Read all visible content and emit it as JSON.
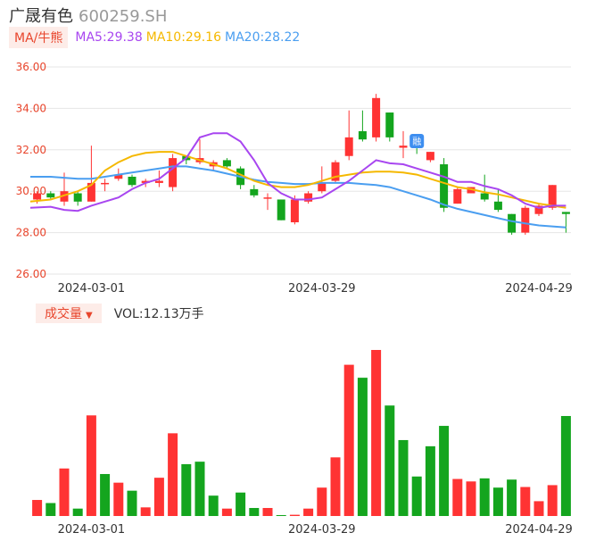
{
  "header": {
    "name": "广晟有色",
    "code": "600259.SH"
  },
  "ma_legend": {
    "badge": "MA/牛熊",
    "items": [
      {
        "text": "MA5:29.38",
        "color": "#a846f0"
      },
      {
        "text": "MA10:29.16",
        "color": "#f5b800"
      },
      {
        "text": "MA20:28.22",
        "color": "#4a9ef0"
      }
    ]
  },
  "volume_legend": {
    "badge": "成交量",
    "value": "VOL:12.13万手"
  },
  "colors": {
    "up": "#ff3333",
    "down": "#14a51e",
    "axis_label": "#e8452c",
    "grid": "#e6e6e6"
  },
  "chart_data": [
    {
      "type": "candlestick",
      "yticks": [
        "36.00",
        "34.00",
        "32.00",
        "30.00",
        "28.00",
        "26.00"
      ],
      "ylim": [
        26,
        36
      ],
      "xticks": [
        {
          "label": "2024-03-01",
          "index": 4
        },
        {
          "label": "2024-03-29",
          "index": 21
        },
        {
          "label": "2024-04-29",
          "index": 37
        }
      ],
      "candles": [
        {
          "o": 29.6,
          "c": 29.9,
          "h": 30.0,
          "l": 29.4
        },
        {
          "o": 29.9,
          "c": 29.7,
          "h": 30.0,
          "l": 29.6
        },
        {
          "o": 29.5,
          "c": 30.0,
          "h": 30.9,
          "l": 29.3
        },
        {
          "o": 29.9,
          "c": 29.5,
          "h": 30.0,
          "l": 29.3
        },
        {
          "o": 29.5,
          "c": 30.4,
          "h": 32.2,
          "l": 29.5
        },
        {
          "o": 30.4,
          "c": 30.4,
          "h": 30.6,
          "l": 30.0
        },
        {
          "o": 30.6,
          "c": 30.8,
          "h": 31.1,
          "l": 30.5
        },
        {
          "o": 30.7,
          "c": 30.3,
          "h": 30.8,
          "l": 30.2
        },
        {
          "o": 30.4,
          "c": 30.5,
          "h": 30.6,
          "l": 30.2
        },
        {
          "o": 30.4,
          "c": 30.5,
          "h": 31.0,
          "l": 30.2
        },
        {
          "o": 30.2,
          "c": 31.6,
          "h": 31.8,
          "l": 30.0
        },
        {
          "o": 31.7,
          "c": 31.5,
          "h": 31.7,
          "l": 31.3
        },
        {
          "o": 31.4,
          "c": 31.6,
          "h": 32.5,
          "l": 31.3
        },
        {
          "o": 31.2,
          "c": 31.4,
          "h": 31.5,
          "l": 31.0
        },
        {
          "o": 31.5,
          "c": 31.2,
          "h": 31.6,
          "l": 31.1
        },
        {
          "o": 31.1,
          "c": 30.3,
          "h": 31.2,
          "l": 30.1
        },
        {
          "o": 30.1,
          "c": 29.8,
          "h": 30.3,
          "l": 29.7
        },
        {
          "o": 29.7,
          "c": 29.7,
          "h": 29.9,
          "l": 29.1
        },
        {
          "o": 29.6,
          "c": 28.6,
          "h": 29.6,
          "l": 28.6
        },
        {
          "o": 28.5,
          "c": 29.6,
          "h": 29.8,
          "l": 28.4
        },
        {
          "o": 29.5,
          "c": 29.9,
          "h": 30.0,
          "l": 29.4
        },
        {
          "o": 30.0,
          "c": 30.4,
          "h": 31.2,
          "l": 29.9
        },
        {
          "o": 30.5,
          "c": 31.4,
          "h": 31.5,
          "l": 30.4
        },
        {
          "o": 31.7,
          "c": 32.6,
          "h": 33.9,
          "l": 31.5
        },
        {
          "o": 32.9,
          "c": 32.5,
          "h": 33.9,
          "l": 32.4
        },
        {
          "o": 32.6,
          "c": 34.5,
          "h": 34.7,
          "l": 32.4
        },
        {
          "o": 33.8,
          "c": 32.6,
          "h": 33.8,
          "l": 32.4
        },
        {
          "o": 32.1,
          "c": 32.2,
          "h": 32.9,
          "l": 31.6
        },
        {
          "o": 32.2,
          "c": 32.1,
          "h": 32.4,
          "l": 31.8
        },
        {
          "o": 31.5,
          "c": 31.9,
          "h": 31.9,
          "l": 31.4
        },
        {
          "o": 31.3,
          "c": 29.2,
          "h": 31.6,
          "l": 29.0
        },
        {
          "o": 29.4,
          "c": 30.1,
          "h": 30.2,
          "l": 29.4
        },
        {
          "o": 29.9,
          "c": 30.2,
          "h": 30.2,
          "l": 29.9
        },
        {
          "o": 29.9,
          "c": 29.6,
          "h": 30.8,
          "l": 29.5
        },
        {
          "o": 29.5,
          "c": 29.1,
          "h": 30.1,
          "l": 29.0
        },
        {
          "o": 28.9,
          "c": 28.0,
          "h": 28.9,
          "l": 27.9
        },
        {
          "o": 28.0,
          "c": 29.2,
          "h": 29.3,
          "l": 27.9
        },
        {
          "o": 28.9,
          "c": 29.3,
          "h": 29.4,
          "l": 28.8
        },
        {
          "o": 29.2,
          "c": 30.3,
          "h": 30.3,
          "l": 29.1
        },
        {
          "o": 29.0,
          "c": 28.9,
          "h": 29.0,
          "l": 28.0
        }
      ],
      "ma5": [
        29.2,
        29.25,
        29.1,
        29.05,
        29.3,
        29.5,
        29.7,
        30.1,
        30.4,
        30.6,
        31.1,
        31.6,
        32.6,
        32.8,
        32.8,
        32.4,
        31.5,
        30.4,
        29.9,
        29.6,
        29.6,
        29.7,
        30.1,
        30.5,
        31.0,
        31.5,
        31.35,
        31.3,
        31.1,
        30.9,
        30.7,
        30.45,
        30.45,
        30.25,
        30.1,
        29.8,
        29.4,
        29.2,
        29.3,
        29.3
      ],
      "ma10": [
        29.5,
        29.6,
        29.8,
        30.0,
        30.3,
        31.0,
        31.4,
        31.7,
        31.85,
        31.9,
        31.9,
        31.7,
        31.5,
        31.3,
        31.1,
        30.8,
        30.5,
        30.3,
        30.2,
        30.2,
        30.3,
        30.5,
        30.7,
        30.8,
        30.9,
        30.95,
        30.95,
        30.9,
        30.8,
        30.6,
        30.4,
        30.2,
        30.1,
        29.95,
        29.85,
        29.7,
        29.55,
        29.4,
        29.3,
        29.2
      ],
      "ma20": [
        30.7,
        30.7,
        30.65,
        30.6,
        30.6,
        30.7,
        30.8,
        30.9,
        31.0,
        31.1,
        31.2,
        31.2,
        31.1,
        31.0,
        30.85,
        30.7,
        30.55,
        30.45,
        30.4,
        30.35,
        30.35,
        30.4,
        30.4,
        30.4,
        30.35,
        30.3,
        30.2,
        30.0,
        29.8,
        29.6,
        29.35,
        29.15,
        29.0,
        28.85,
        28.7,
        28.55,
        28.45,
        28.35,
        28.3,
        28.25
      ],
      "markers": [
        {
          "index": 28,
          "text": "融"
        }
      ]
    },
    {
      "type": "bar",
      "title": "成交量",
      "values": [
        2.6,
        2.1,
        7.7,
        1.2,
        16.3,
        6.8,
        5.4,
        4.1,
        1.4,
        6.2,
        13.4,
        8.4,
        8.8,
        3.3,
        1.2,
        3.8,
        1.3,
        1.3,
        0.15,
        0.2,
        1.2,
        4.6,
        9.5,
        24.5,
        22.4,
        26.9,
        17.9,
        12.3,
        6.4,
        11.3,
        14.6,
        6.0,
        5.6,
        6.1,
        4.6,
        5.9,
        4.7,
        2.4,
        5.0,
        16.2
      ],
      "up": [
        true,
        false,
        true,
        false,
        true,
        false,
        true,
        false,
        true,
        true,
        true,
        false,
        false,
        false,
        true,
        false,
        false,
        true,
        false,
        true,
        true,
        true,
        true,
        true,
        false,
        true,
        false,
        false,
        false,
        false,
        false,
        true,
        true,
        false,
        false,
        false,
        true,
        true,
        true,
        false
      ]
    }
  ]
}
